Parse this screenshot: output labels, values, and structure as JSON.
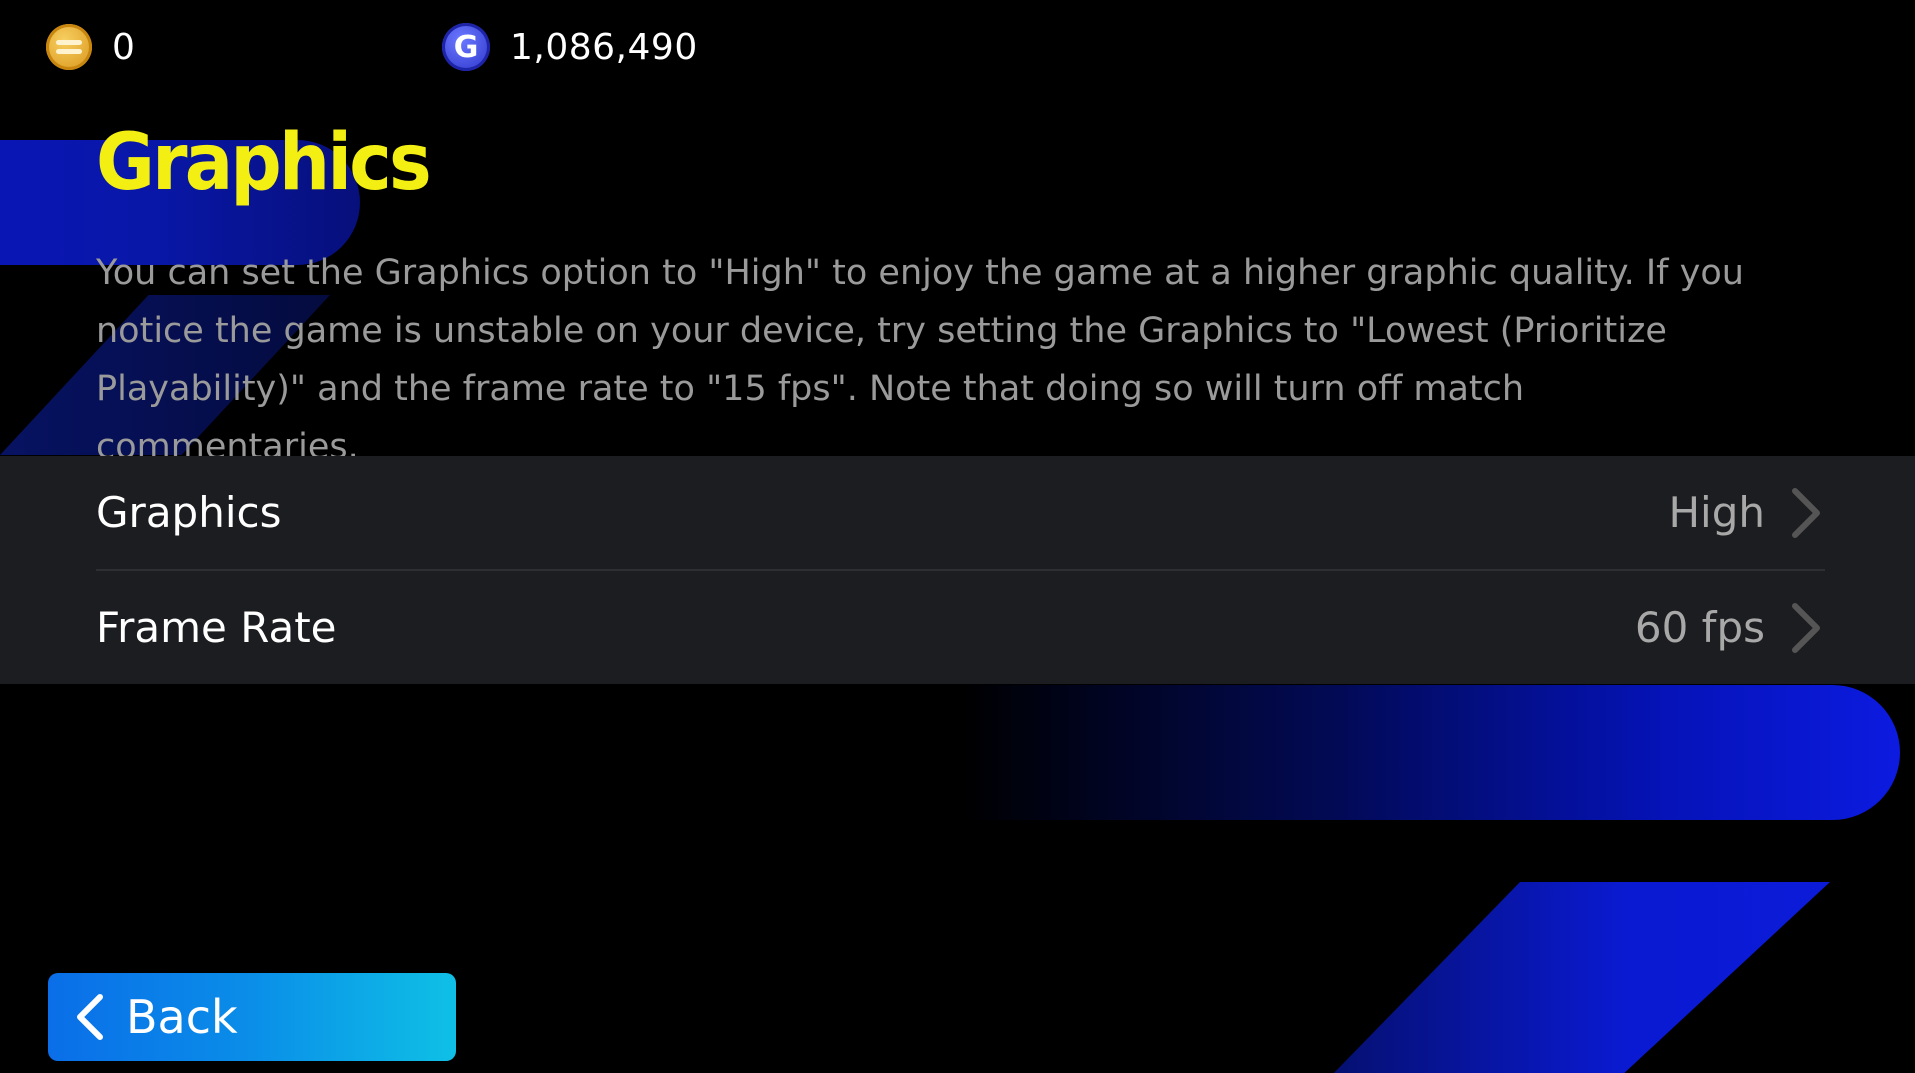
{
  "currencies": {
    "coins": {
      "icon": "coin-icon",
      "value": "0"
    },
    "gp": {
      "icon": "gp-icon",
      "letter": "G",
      "value": "1,086,490"
    }
  },
  "header": {
    "title": "Graphics",
    "description": "You can set the Graphics option to \"High\" to enjoy the game at a higher graphic quality. If you notice the game is unstable on your device, try setting the Graphics to \"Lowest (Prioritize Playability)\" and the frame rate to \"15 fps\". Note that doing so will turn off match commentaries."
  },
  "settings": {
    "items": [
      {
        "label": "Graphics",
        "value": "High",
        "icon": "chevron-right-icon"
      },
      {
        "label": "Frame Rate",
        "value": "60 fps",
        "icon": "chevron-right-icon"
      }
    ]
  },
  "footer": {
    "back_label": "Back",
    "back_icon": "chevron-left-icon"
  },
  "colors": {
    "title": "#f3ef13",
    "accent_blue": "#0c1be0",
    "back_button_start": "#0a6ee8",
    "back_button_end": "#0fc0e6",
    "panel": "#1c1d20"
  }
}
